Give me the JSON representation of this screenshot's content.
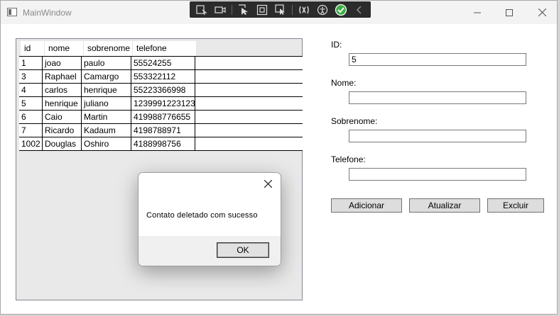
{
  "window": {
    "title": "MainWindow",
    "accent_color": "#0078d4"
  },
  "title_buttons": {
    "minimize_icon": "minimize-icon",
    "maximize_icon": "maximize-icon",
    "close_icon": "close-icon"
  },
  "debug_toolbar": {
    "icons": [
      "select-element-icon",
      "video-icon",
      "pointer-icon",
      "frame-icon",
      "track-focus-icon",
      "hot-reload-icon",
      "accessibility-icon",
      "check-icon",
      "collapse-chevron-icon"
    ]
  },
  "grid": {
    "columns": [
      "id",
      "nome",
      "sobrenome",
      "telefone"
    ],
    "rows": [
      {
        "id": "1",
        "nome": "joao",
        "sobrenome": "paulo",
        "telefone": "55524255"
      },
      {
        "id": "3",
        "nome": "Raphael",
        "sobrenome": "Camargo",
        "telefone": "553322112"
      },
      {
        "id": "4",
        "nome": "carlos",
        "sobrenome": "henrique",
        "telefone": "55223366998"
      },
      {
        "id": "5",
        "nome": "henrique",
        "sobrenome": "juliano",
        "telefone": "1239991223123"
      },
      {
        "id": "6",
        "nome": "Caio",
        "sobrenome": "Martin",
        "telefone": "419988776655"
      },
      {
        "id": "7",
        "nome": "Ricardo",
        "sobrenome": "Kadaum",
        "telefone": "4198788971"
      },
      {
        "id": "1002",
        "nome": "Douglas",
        "sobrenome": "Oshiro",
        "telefone": "4188998756"
      }
    ]
  },
  "form": {
    "id_label": "ID:",
    "id_value": "5",
    "nome_label": "Nome:",
    "nome_value": "",
    "sobrenome_label": "Sobrenome:",
    "sobrenome_value": "",
    "telefone_label": "Telefone:",
    "telefone_value": ""
  },
  "buttons": {
    "adicionar": "Adicionar",
    "atualizar": "Atualizar",
    "excluir": "Excluir"
  },
  "dialog": {
    "message": "Contato deletado com sucesso",
    "ok_label": "OK"
  }
}
